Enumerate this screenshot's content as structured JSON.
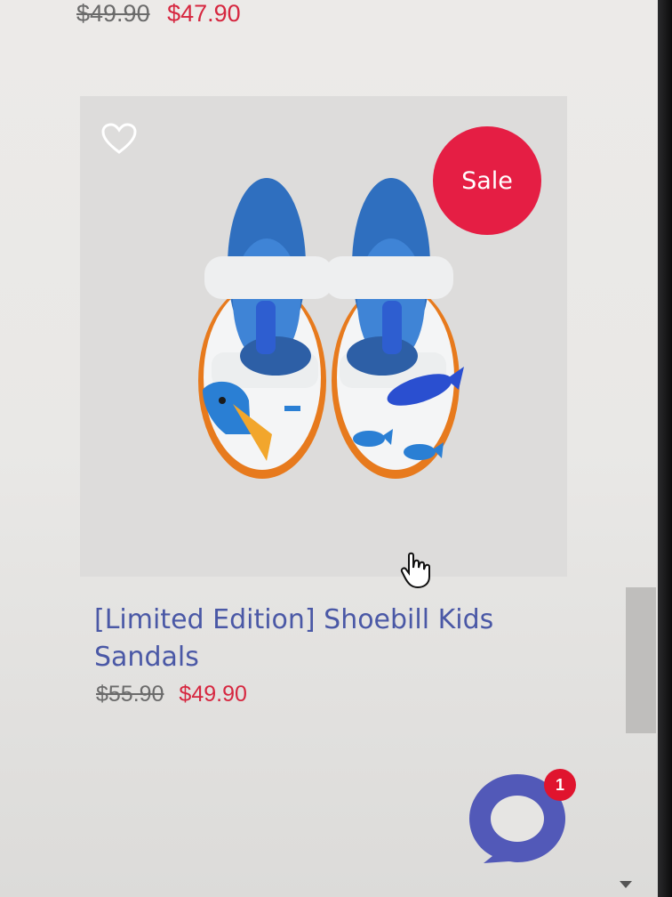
{
  "previous_product": {
    "original_price": "$49.90",
    "sale_price": "$47.90"
  },
  "product": {
    "badge": "Sale",
    "title": "[Limited Edition] Shoebill Kids Sandals",
    "original_price": "$55.90",
    "sale_price": "$49.90",
    "image_alt_icon": "shoe-product-image"
  },
  "chat_widget": {
    "unread_count": "1"
  },
  "colors": {
    "accent_blue": "#4a58a6",
    "sale_red": "#e51e44",
    "price_red": "#d6263f"
  }
}
